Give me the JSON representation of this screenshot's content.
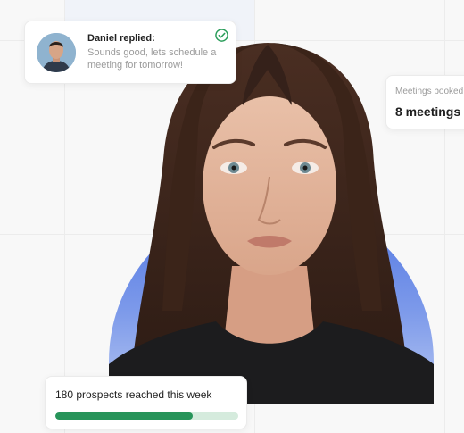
{
  "notification": {
    "name": "Daniel replied:",
    "message": "Sounds good, lets schedule a meeting for tomorrow!",
    "icons": [
      "avatar",
      "check-circle-icon"
    ],
    "check_color": "#2a9d5a"
  },
  "meetings": {
    "label": "Meetings booked",
    "value": "8 meetings"
  },
  "prospects": {
    "text": "180 prospects reached this week",
    "progress": 0.75,
    "bar_color": "#27945a",
    "track_color": "#d5ebdd"
  },
  "colors": {
    "arch_top": "#4f75e3",
    "arch_bottom": "#b8c8f2",
    "background": "#f8f8f8"
  }
}
